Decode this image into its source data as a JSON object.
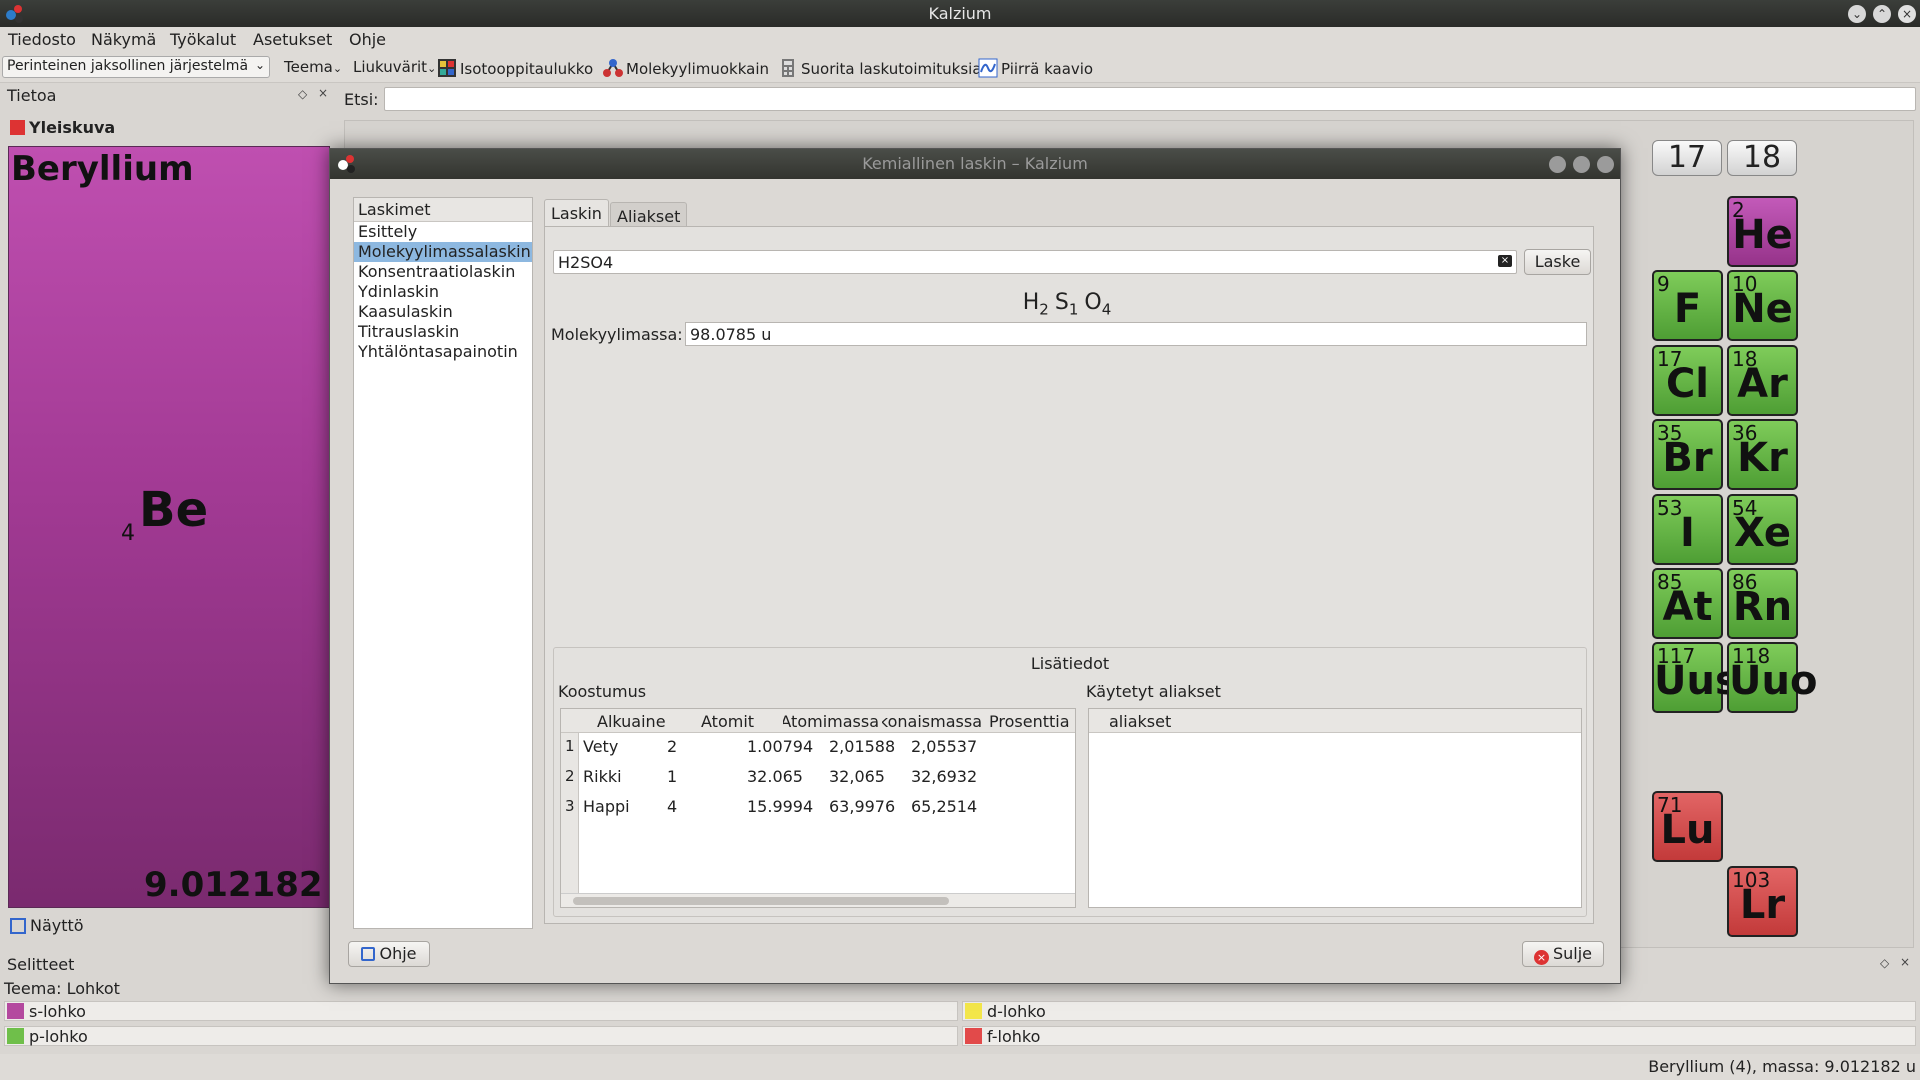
{
  "window": {
    "title": "Kalzium"
  },
  "menu": [
    "Tiedosto",
    "Näkymä",
    "Työkalut",
    "Asetukset",
    "Ohje"
  ],
  "toolbar": {
    "table_combo": "Perinteinen jaksollinen järjestelmä",
    "theme": "Teema",
    "gradients": "Liukuvärit",
    "isotope": "Isotooppitaulukko",
    "molecule": "Molekyylimuokkain",
    "calc": "Suorita laskutoimituksia",
    "plot": "Piirrä kaavio"
  },
  "info_dock": {
    "title": "Tietoa",
    "overview": "Yleiskuva",
    "element_name": "Beryllium",
    "element_symbol": "Be",
    "element_number": "4",
    "element_mass": "9.012182 u",
    "view": "Näyttö"
  },
  "search": {
    "label": "Etsi:"
  },
  "periodic_table": {
    "groups": [
      "17",
      "18"
    ],
    "elements": [
      {
        "n": "2",
        "s": "He",
        "block": "s"
      },
      {
        "n": "9",
        "s": "F",
        "block": "p"
      },
      {
        "n": "10",
        "s": "Ne",
        "block": "p"
      },
      {
        "n": "17",
        "s": "Cl",
        "block": "p"
      },
      {
        "n": "18",
        "s": "Ar",
        "block": "p"
      },
      {
        "n": "35",
        "s": "Br",
        "block": "p"
      },
      {
        "n": "36",
        "s": "Kr",
        "block": "p"
      },
      {
        "n": "53",
        "s": "I",
        "block": "p"
      },
      {
        "n": "54",
        "s": "Xe",
        "block": "p"
      },
      {
        "n": "85",
        "s": "At",
        "block": "p"
      },
      {
        "n": "86",
        "s": "Rn",
        "block": "p"
      },
      {
        "n": "117",
        "s": "Uus",
        "block": "p"
      },
      {
        "n": "118",
        "s": "Uuo",
        "block": "p"
      },
      {
        "n": "71",
        "s": "Lu",
        "block": "f"
      },
      {
        "n": "103",
        "s": "Lr",
        "block": "f"
      }
    ]
  },
  "legend": {
    "title": "Selitteet",
    "theme": "Teema: Lohkot",
    "items": [
      {
        "label": "s-lohko",
        "color": "#b4499f"
      },
      {
        "label": "d-lohko",
        "color": "#f3e64a"
      },
      {
        "label": "p-lohko",
        "color": "#6fbf4a"
      },
      {
        "label": "f-lohko",
        "color": "#e24a4a"
      }
    ]
  },
  "status": "Beryllium (4), massa: 9.012182 u",
  "dialog": {
    "title": "Kemiallinen laskin – Kalzium",
    "list_header": "Laskimet",
    "calculators": [
      "Esittely",
      "Molekyylimassalaskin",
      "Konsentraatiolaskin",
      "Ydinlaskin",
      "Kaasulaskin",
      "Titrauslaskin",
      "Yhtälöntasapainotin"
    ],
    "selected_index": 1,
    "tabs": [
      "Laskin",
      "Aliakset"
    ],
    "formula_input": "H2SO4",
    "calc_button": "Laske",
    "formula_parts": [
      {
        "el": "H",
        "sub": "2"
      },
      {
        "el": "S",
        "sub": "1"
      },
      {
        "el": "O",
        "sub": "4"
      }
    ],
    "mass_label": "Molekyylimassa:",
    "mass_value": "98.0785 u",
    "info_title": "Lisätiedot",
    "composition_label": "Koostumus",
    "aliases_label": "Käytetyt aliakset",
    "columns": [
      "Alkuaine",
      "Atomit",
      "Atomimassa",
      "Kokonaismassa",
      "Prosenttia"
    ],
    "rows": [
      [
        "Vety",
        "2",
        "1.00794",
        "2,01588",
        "2,05537"
      ],
      [
        "Rikki",
        "1",
        "32.065",
        "32,065",
        "32,6932"
      ],
      [
        "Happi",
        "4",
        "15.9994",
        "63,9976",
        "65,2514"
      ]
    ],
    "alias_column": "aliakset",
    "help_button": "Ohje",
    "close_button": "Sulje"
  }
}
